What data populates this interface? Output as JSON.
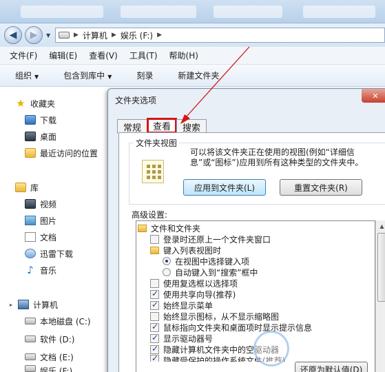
{
  "address": {
    "segments": [
      "计算机",
      "娱乐 (F:)"
    ]
  },
  "menu": [
    "文件(F)",
    "编辑(E)",
    "查看(V)",
    "工具(T)",
    "帮助(H)"
  ],
  "toolbar": {
    "organize": "组织",
    "include": "包含到库中",
    "burn": "刻录",
    "new_folder": "新建文件夹"
  },
  "sidebar": {
    "favorites": "收藏夹",
    "fav_items": [
      "下载",
      "桌面",
      "最近访问的位置"
    ],
    "libraries": "库",
    "lib_items": [
      "视频",
      "图片",
      "文档",
      "迅雷下载",
      "音乐"
    ],
    "computer": "计算机",
    "drives": [
      "本地磁盘 (C:)",
      "软件 (D:)",
      "文档 (E:)",
      "娱乐 (F:)"
    ]
  },
  "dialog": {
    "title": "文件夹选项",
    "tabs": [
      "常规",
      "查看",
      "搜索"
    ],
    "active_tab": "查看",
    "folder_views_legend": "文件夹视图",
    "folder_views_desc": "可以将该文件夹正在使用的视图(例如“详细信息”或“图标”)应用到所有这种类型的文件夹中。",
    "apply_button": "应用到文件夹(L)",
    "reset_button": "重置文件夹(R)",
    "advanced_label": "高级设置:",
    "tree": [
      {
        "type": "folder",
        "label": "文件和文件夹"
      },
      {
        "type": "checkbox",
        "checked": false,
        "label": "登录时还原上一个文件夹窗口"
      },
      {
        "type": "folder",
        "label": "键入列表视图时"
      },
      {
        "type": "radio",
        "checked": true,
        "label": "在视图中选择键入项"
      },
      {
        "type": "radio",
        "checked": false,
        "label": "自动键入到“搜索”框中"
      },
      {
        "type": "checkbox",
        "checked": false,
        "label": "使用复选框以选择项"
      },
      {
        "type": "checkbox",
        "checked": true,
        "label": "使用共享向导(推荐)"
      },
      {
        "type": "checkbox",
        "checked": true,
        "label": "始终显示菜单"
      },
      {
        "type": "checkbox",
        "checked": false,
        "label": "始终显示图标，从不显示缩略图"
      },
      {
        "type": "checkbox",
        "checked": true,
        "label": "鼠标指向文件夹和桌面项时显示提示信息"
      },
      {
        "type": "checkbox",
        "checked": true,
        "label": "显示驱动器号"
      },
      {
        "type": "checkbox",
        "checked": true,
        "label": "隐藏计算机文件夹中的空驱动器"
      },
      {
        "type": "checkbox",
        "checked": true,
        "label": "隐藏受保护的操作系统文件(推荐)"
      }
    ],
    "restore_defaults": "还原为默认值(D)"
  },
  "colors": {
    "highlight": "#d41515",
    "title_bg": "#d4e3f3"
  },
  "icons": [
    "back-arrow-icon",
    "forward-arrow-icon",
    "drive-icon",
    "star-icon",
    "folder-icon",
    "close-icon"
  ]
}
